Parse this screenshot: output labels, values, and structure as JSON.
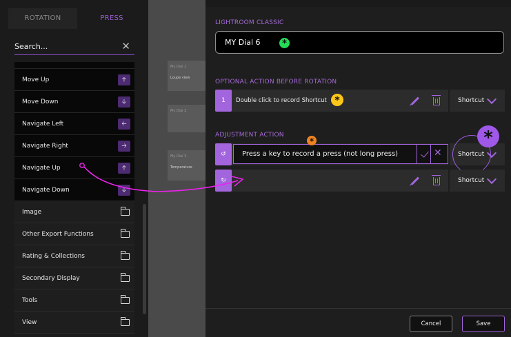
{
  "sidebar": {
    "tabs": [
      "ROTATION",
      "PRESS"
    ],
    "active_tab": "PRESS",
    "search": {
      "placeholder": "Search..."
    },
    "sub_items": [
      {
        "label": "Move Up",
        "icon": "arrow-up-icon",
        "glyph": "🡡"
      },
      {
        "label": "Move Down",
        "icon": "arrow-down-icon",
        "glyph": "🡣"
      },
      {
        "label": "Navigate Left",
        "icon": "arrow-left-icon",
        "glyph": "🡠"
      },
      {
        "label": "Navigate Right",
        "icon": "arrow-right-icon",
        "glyph": "🡢"
      },
      {
        "label": "Navigate Up",
        "icon": "arrow-up-icon",
        "glyph": "🡡"
      },
      {
        "label": "Navigate Down",
        "icon": "arrow-down-icon",
        "glyph": "🡣"
      }
    ],
    "categories": [
      "Image",
      "Other Export Functions",
      "Rating & Collections",
      "Secondary Display",
      "Tools",
      "View"
    ]
  },
  "dials": [
    {
      "name": "My Dial 1",
      "value": "Loupe view"
    },
    {
      "name": "My Dial 2",
      "value": ""
    },
    {
      "name": "My Dial 3",
      "value": "Temperature"
    }
  ],
  "panel": {
    "app_label": "LIGHTROOM CLASSIC",
    "dial_name": "MY Dial 6",
    "optional_label": "OPTIONAL ACTION BEFORE ROTATION",
    "optional_action": {
      "index": "1",
      "text": "Double click to record Shortcut",
      "type": "Shortcut"
    },
    "adjustment_label": "ADJUSTMENT ACTION",
    "adjust_rows": [
      {
        "icon": "rotate-ccw-icon",
        "glyph": "↺",
        "record_text": "Press a key to record a press (not long press)",
        "type": "Shortcut"
      },
      {
        "icon": "rotate-cw-icon",
        "glyph": "↻",
        "record_text": "",
        "type": "Shortcut"
      }
    ],
    "cancel_label": "Cancel",
    "save_label": "Save"
  },
  "colors": {
    "accent": "#a365dd",
    "highlight_green": "#22dd55",
    "highlight_yellow": "#ffc61a",
    "highlight_orange": "#ef8420",
    "arrow_magenta": "#ee22ee"
  }
}
